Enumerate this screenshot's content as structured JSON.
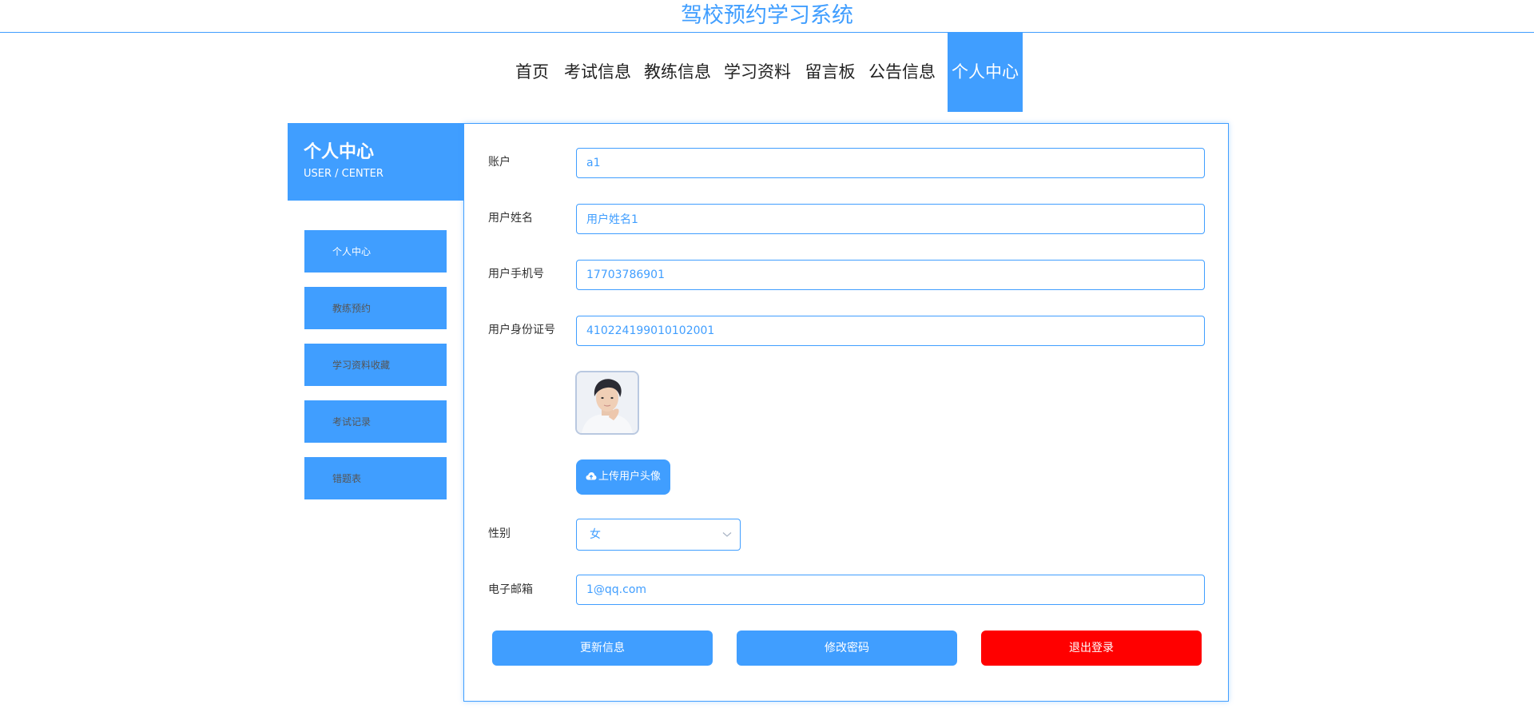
{
  "site": {
    "title": "驾校预约学习系统"
  },
  "nav": {
    "items": [
      {
        "label": "首页"
      },
      {
        "label": "考试信息"
      },
      {
        "label": "教练信息"
      },
      {
        "label": "学习资料"
      },
      {
        "label": "留言板"
      },
      {
        "label": "公告信息"
      },
      {
        "label": "个人中心",
        "active": true
      }
    ]
  },
  "sidebar": {
    "title": "个人中心",
    "subtitle": "USER / CENTER",
    "items": [
      {
        "label": "个人中心",
        "active": true
      },
      {
        "label": "教练预约"
      },
      {
        "label": "学习资料收藏"
      },
      {
        "label": "考试记录"
      },
      {
        "label": "错题表"
      }
    ]
  },
  "form": {
    "account": {
      "label": "账户",
      "value": "a1"
    },
    "name": {
      "label": "用户姓名",
      "value": "用户姓名1"
    },
    "phone": {
      "label": "用户手机号",
      "value": "17703786901"
    },
    "id_card": {
      "label": "用户身份证号",
      "value": "410224199010102001"
    },
    "upload_label": "上传用户头像",
    "gender": {
      "label": "性别",
      "value": "女"
    },
    "email": {
      "label": "电子邮箱",
      "value": "1@qq.com"
    }
  },
  "actions": {
    "update": "更新信息",
    "change_password": "修改密码",
    "logout": "退出登录"
  },
  "colors": {
    "accent": "#409eff",
    "danger": "#ff0000"
  },
  "icons": {
    "upload": "cloud-upload-icon",
    "select": "chevron-down-icon"
  }
}
